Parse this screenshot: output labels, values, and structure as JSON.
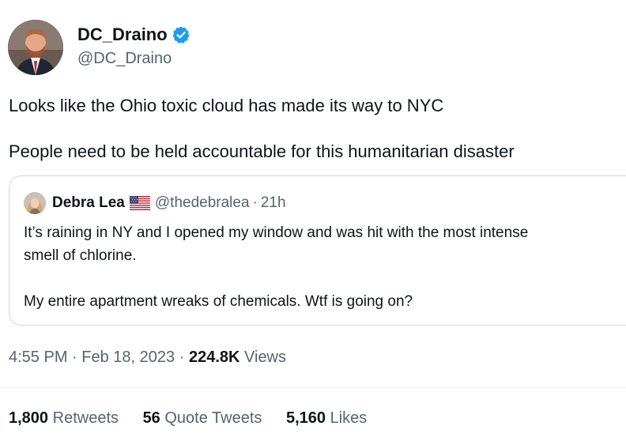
{
  "author": {
    "display_name": "DC_Draino",
    "handle": "@DC_Draino",
    "verified_color": "#1d9bf0"
  },
  "tweet": {
    "line1": "Looks like the Ohio toxic cloud has made its way to NYC",
    "line2": "People need to be held accountable for this humanitarian disaster"
  },
  "quoted": {
    "display_name": "Debra Lea",
    "flag_icon": "us-flag-icon",
    "handle": "@thedebralea",
    "separator": "·",
    "time": "21h",
    "line1": "It’s raining in NY and I opened my window and was hit with the most intense",
    "line2": "smell of chlorine.",
    "line3": "My entire apartment wreaks of chemicals. Wtf is going on?"
  },
  "meta": {
    "time": "4:55 PM",
    "sep1": "·",
    "date": "Feb 18, 2023",
    "sep2": "·",
    "views_count": "224.8K",
    "views_label": "Views"
  },
  "stats": {
    "retweets_count": "1,800",
    "retweets_label": "Retweets",
    "quotes_count": "56",
    "quotes_label": "Quote Tweets",
    "likes_count": "5,160",
    "likes_label": "Likes"
  }
}
